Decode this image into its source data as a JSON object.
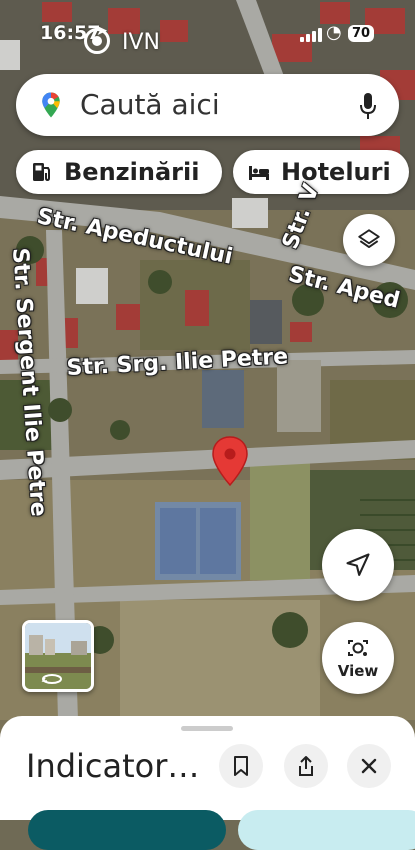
{
  "status_bar": {
    "time": "16:57",
    "carrier": "IVN",
    "battery": "70",
    "icons": [
      "location-arrow-icon",
      "signal-icon",
      "wifi-icon",
      "battery-icon"
    ]
  },
  "search": {
    "placeholder": "Caută aici",
    "icons": [
      "google-maps-pin-icon",
      "microphone-icon"
    ]
  },
  "chips": [
    {
      "label": "Benzinării",
      "icon": "gas-station-icon"
    },
    {
      "label": "Hoteluri",
      "icon": "bed-icon"
    }
  ],
  "map": {
    "streets": [
      {
        "name": "Str. Apeductului"
      },
      {
        "name": "Str. Aped"
      },
      {
        "name": "Str. Srg. Ilie Petre"
      },
      {
        "name": "Str. Sergent Ilie Petre"
      },
      {
        "name": "Str. V"
      }
    ],
    "marker": {
      "color": "#e53935"
    }
  },
  "controls": {
    "layers": "layers-icon",
    "my_location": "navigation-arrow-icon",
    "view_label": "View",
    "view_icon": "lens-camera-icon",
    "street_view_icon": "street-view-icon"
  },
  "bottom_sheet": {
    "title": "Indicator…",
    "actions": [
      "bookmark-icon",
      "share-icon",
      "close-icon"
    ],
    "pill_colors": [
      "#0b5b63",
      "#c8ecf0"
    ]
  },
  "colors": {
    "accent": "#e53935",
    "road": "#a9a9a4",
    "roof_red": "#a0302d"
  }
}
